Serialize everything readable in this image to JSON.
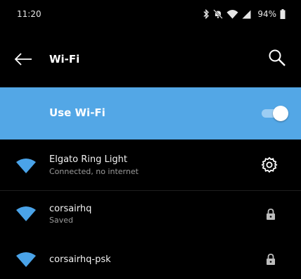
{
  "status_bar": {
    "time": "11:20",
    "battery": "94%",
    "icons": [
      "bluetooth-icon",
      "mute-icon",
      "wifi-status-icon",
      "cell-signal-icon",
      "battery-icon"
    ]
  },
  "app_bar": {
    "title": "Wi-Fi",
    "back_icon": "back-arrow-icon",
    "search_icon": "search-icon"
  },
  "wifi_toggle": {
    "label": "Use Wi-Fi",
    "enabled": true,
    "background_color": "#53a7e6"
  },
  "networks": [
    {
      "name": "Elgato Ring Light",
      "status": "Connected, no internet",
      "icon": "wifi-signal-icon",
      "action_icon": "gear-icon"
    },
    {
      "name": "corsairhq",
      "status": "Saved",
      "icon": "wifi-signal-icon",
      "action_icon": "lock-icon"
    },
    {
      "name": "corsairhq-psk",
      "status": "",
      "icon": "wifi-signal-icon",
      "action_icon": "lock-icon"
    }
  ],
  "colors": {
    "accent": "#53a7e6",
    "wifi_icon": "#4aa3e8",
    "background": "#000000"
  }
}
